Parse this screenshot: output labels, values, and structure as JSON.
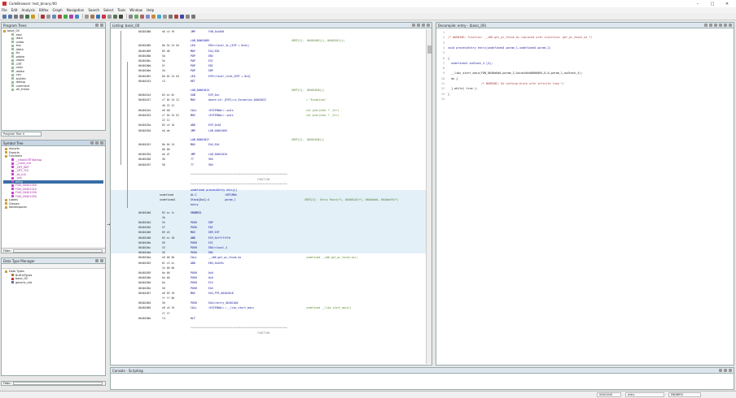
{
  "title": "CodeBrowser: test_binary:/00",
  "menu": [
    "File",
    "Edit",
    "Analysis",
    "Bitfox",
    "Graph",
    "Navigation",
    "Search",
    "Select",
    "Tools",
    "Window",
    "Help"
  ],
  "program_tree": {
    "title": "Program Trees",
    "root": "basic_00",
    "items": [
      ".text",
      ".data",
      ".rdata",
      ".bss",
      ".idata",
      ".tls",
      ".pdata",
      ".xdata",
      ".CRT",
      ".reloc",
      ".edata",
      ".rsrc",
      ".buildid",
      ".debug",
      ".comment",
      ".eh_frame"
    ],
    "tab_label": "Program Tree"
  },
  "symbol_tree": {
    "title": "Symbol Tree",
    "items": [
      {
        "label": "Imports",
        "depth": 0,
        "type": "folder"
      },
      {
        "label": "Exports",
        "depth": 0,
        "type": "folder"
      },
      {
        "label": "Functions",
        "depth": 0,
        "type": "folder"
      },
      {
        "label": "__tmainCRTStartup",
        "depth": 1,
        "type": "fn"
      },
      {
        "label": "__main_init",
        "depth": 1,
        "type": "fn"
      },
      {
        "label": "_CRT_INIT",
        "depth": 1,
        "type": "fn"
      },
      {
        "label": "_CRT_TLS",
        "depth": 1,
        "type": "fn"
      },
      {
        "label": "_tls_init",
        "depth": 1,
        "type": "fn"
      },
      {
        "label": "_xcb",
        "depth": 1,
        "type": "fn"
      },
      {
        "label": "entry",
        "depth": 1,
        "type": "fn",
        "selected": true
      },
      {
        "label": "FUN_00401000",
        "depth": 1,
        "type": "fn"
      },
      {
        "label": "FUN_00401010",
        "depth": 1,
        "type": "fn"
      },
      {
        "label": "FUN_00401030",
        "depth": 1,
        "type": "fn"
      },
      {
        "label": "FUN_00401050",
        "depth": 1,
        "type": "fn"
      },
      {
        "label": "Labels",
        "depth": 0,
        "type": "folder"
      },
      {
        "label": "Classes",
        "depth": 0,
        "type": "folder"
      },
      {
        "label": "Namespaces",
        "depth": 0,
        "type": "folder"
      }
    ],
    "filter_label": "Filter:"
  },
  "data_type": {
    "title": "Data Type Manager",
    "items": [
      {
        "label": "Data Types",
        "depth": 0
      },
      {
        "label": "BuiltInTypes",
        "depth": 1
      },
      {
        "label": "basic_00",
        "depth": 1
      },
      {
        "label": "generic_clib",
        "depth": 1
      }
    ],
    "filter_label": "Filter:"
  },
  "listing": {
    "title": "Listing: basic_00",
    "lines": [
      {
        "a": "00401000",
        "b": "e8 c4 f6",
        "m": "JMP",
        "o": "FUN_0x1d60",
        "c": ""
      },
      {
        "lbl": "LAB_00401005",
        "x": "XREF[1]:  00401002(j), 00401011(j)"
      },
      {
        "a": "00401005",
        "b": "8b 54 24 04",
        "m": "LEA",
        "o": "EDX=>local_4c,[ESP + 0x4c]"
      },
      {
        "a": "00401009",
        "b": "89 d0",
        "m": "MOV",
        "o": "EAX,EDX"
      },
      {
        "a": "0040100b",
        "b": "5b",
        "m": "POP",
        "o": "EBX"
      },
      {
        "a": "0040100c",
        "b": "5e",
        "m": "POP",
        "o": "ESI"
      },
      {
        "a": "0040100d",
        "b": "5f",
        "m": "POP",
        "o": "EDI"
      },
      {
        "a": "0040100e",
        "b": "5d",
        "m": "POP",
        "o": "EBP"
      },
      {
        "a": "0040100f",
        "b": "8d 64 24 04",
        "m": "LEA",
        "o": "ESP=>local_res0,[ESP + 0x4]"
      },
      {
        "a": "00401013",
        "b": "c3",
        "m": "RET",
        "o": ""
      },
      {
        "lbl": "LAB_00401014",
        "x": "XREF[1]:  00401020(j)"
      },
      {
        "a": "00401014",
        "b": "83 ec 0c",
        "m": "SUB",
        "o": "ESP,0xc"
      },
      {
        "a": "00401017",
        "b": "c7 04 24 22",
        "m": "MOV",
        "o": "dword ptr [ESP]=>s_Exception_00404022",
        "c": "= \"Exception\""
      },
      {
        "a": "",
        "b": "40 22 22",
        "m": "",
        "o": ""
      },
      {
        "a": "0040101e",
        "b": "e8 00",
        "m": "CALL",
        "o": "<EXTERNAL>::puts",
        "c": "int puts(char * _Str)"
      },
      {
        "a": "00401023",
        "b": "c7 04 24 01",
        "m": "MOV",
        "o": "<EXTERNAL>::puts",
        "c": "int puts(char * _Str)"
      },
      {
        "a": "",
        "b": "22 12",
        "m": "",
        "o": ""
      },
      {
        "a": "0040102a",
        "b": "83 c4 10",
        "m": "ADD",
        "o": "ESP,0x10"
      },
      {
        "a": "0040102d",
        "b": "eb de",
        "m": "JMP",
        "o": "LAB_00401005"
      },
      {
        "lbl": "LAB_0040102f",
        "x": "XREF[1]:  00401046(j)"
      },
      {
        "a": "0040102f",
        "b": "8b 04 24",
        "m": "MOV",
        "o": "EAX,EAX"
      },
      {
        "a": "",
        "b": "00 00",
        "m": "",
        "o": ""
      },
      {
        "a": "00401034",
        "b": "eb d7",
        "m": "JMP",
        "o": "LAB_0040102d"
      },
      {
        "a": "00401036",
        "b": "90",
        "m": "??",
        "o": "90h"
      },
      {
        "a": "00401037",
        "b": "90",
        "m": "??",
        "o": "90h"
      }
    ],
    "func_header": {
      "stars": "**************************************************************",
      "name": "FUNCTION",
      "sig": "undefined processEntry entry()",
      "vars": [
        {
          "t": "undefined",
          "n": "AL:1",
          "d": "<RETURN>"
        },
        {
          "t": "undefined4",
          "n": "Stack[0x4]:4",
          "d": "param_1"
        }
      ],
      "label": "entry",
      "xref": "XREF[3]:  Entry Point(*), 00400120(*), 0040a4e0, 0040a4f8(*)"
    },
    "lines2": [
      {
        "a": "00401040",
        "b": "83 ec 1c",
        "m": "ENDBR32",
        "o": ""
      },
      {
        "a": "",
        "b": "3b",
        "m": "",
        "o": ""
      },
      {
        "a": "00401044",
        "b": "55",
        "m": "PUSH",
        "o": "EBP"
      },
      {
        "a": "00401045",
        "b": "57",
        "m": "PUSH",
        "o": "EDI"
      },
      {
        "a": "00401046",
        "b": "89 e5",
        "m": "MOV",
        "o": "EBP,ESP"
      },
      {
        "a": "00401048",
        "b": "83 ec 18",
        "m": "AND",
        "o": "ESP,0xfffffff0"
      },
      {
        "a": "0040104b",
        "b": "56",
        "m": "PUSH",
        "o": "ESI"
      },
      {
        "a": "0040104c",
        "b": "53",
        "m": "PUSH",
        "o": "EBX=>local_4"
      },
      {
        "a": "0040104d",
        "b": "56",
        "m": "PUSH",
        "o": "EBX"
      },
      {
        "a": "0040104e",
        "b": "e8 00 00",
        "m": "CALL",
        "o": "__x86.get_pc_thunk.bx",
        "c": "undefined __x86.get_pc_thunk.bx()"
      },
      {
        "a": "00401053",
        "b": "81 c3 4c",
        "m": "ADD",
        "o": "EBX,0x2e9c"
      },
      {
        "a": "",
        "b": "2e 00 00",
        "m": "",
        "o": ""
      },
      {
        "a": "00401059",
        "b": "6a 00",
        "m": "PUSH",
        "o": "0x0"
      },
      {
        "a": "0040105b",
        "b": "6a 00",
        "m": "PUSH",
        "o": "0x0"
      },
      {
        "a": "0040105d",
        "b": "6a",
        "m": "PUSH",
        "o": "ECX"
      },
      {
        "a": "0040105e",
        "b": "50",
        "m": "PUSH",
        "o": "EAX"
      },
      {
        "a": "0040105f",
        "b": "e8 03 f0",
        "m": "MOV",
        "o": "EAX,PTR_00404018"
      },
      {
        "a": "",
        "b": "ff ff 8d",
        "m": "",
        "o": ""
      },
      {
        "a": "00401064",
        "b": "50",
        "m": "PUSH",
        "o": "EAX=>entry_00401040"
      },
      {
        "a": "00401065",
        "b": "e8 c6 fb",
        "m": "CALL",
        "o": "<EXTERNAL>::__libc_start_main",
        "c": "undefined __libc_start_main()"
      },
      {
        "a": "",
        "b": "ff ff",
        "m": "",
        "o": ""
      },
      {
        "a": "0040106a",
        "b": "f4",
        "m": "HLT",
        "o": ""
      }
    ],
    "footer": "FUNCTION"
  },
  "decompile": {
    "title": "Decompile: entry - (basic_00)",
    "lines": [
      {
        "n": "1",
        "t": ""
      },
      {
        "n": "2",
        "t": "/* WARNING: Function: __x86.get_pc_thunk.bx replaced with injection: get_pc_thunk_bx */"
      },
      {
        "n": "3",
        "t": ""
      },
      {
        "n": "4",
        "t": "void processEntry entry(undefined4 param_1,undefined4 param_2)"
      },
      {
        "n": "5",
        "t": ""
      },
      {
        "n": "6",
        "t": "{"
      },
      {
        "n": "7",
        "t": "  undefined1 auStack_4 [4];"
      },
      {
        "n": "8",
        "t": ""
      },
      {
        "n": "9",
        "t": "  __libc_start_main(FUN_0040a0a0,param_2,&stack0x00000004,0,0,param_1,auStack_4);"
      },
      {
        "n": "10",
        "t": "  do {"
      },
      {
        "n": "11",
        "t": "                    /* WARNING: Do nothing block with infinite loop */"
      },
      {
        "n": "12",
        "t": "  } while( true );"
      },
      {
        "n": "13",
        "t": "}"
      },
      {
        "n": "14",
        "t": ""
      }
    ]
  },
  "console": {
    "title": "Console - Scripting"
  },
  "status": {
    "address": "00401040",
    "function": "entry",
    "instruction": "ENDBR32"
  }
}
